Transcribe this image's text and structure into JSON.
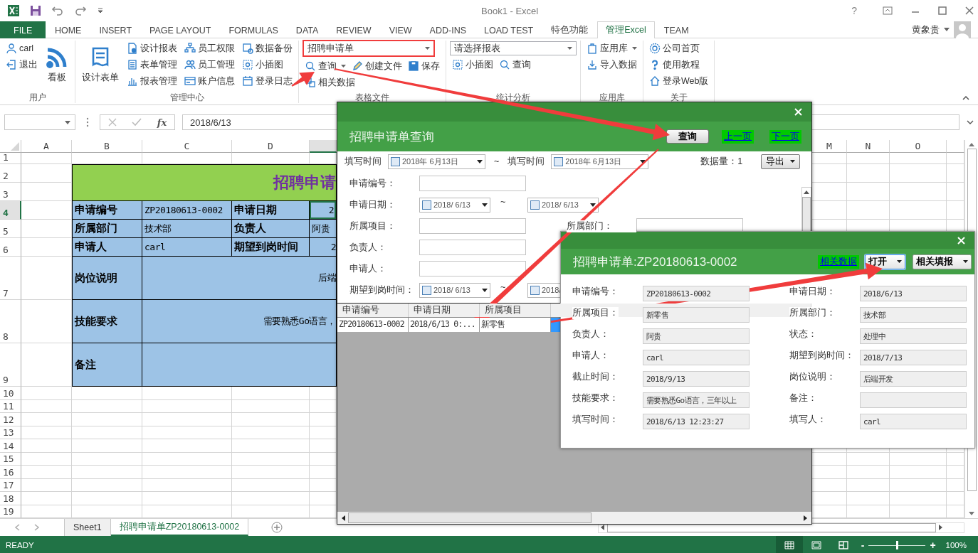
{
  "window": {
    "title": "Book1 - Excel",
    "help": "?"
  },
  "tabs": [
    {
      "label": "FILE",
      "kind": "file",
      "selected": false
    },
    {
      "label": "HOME",
      "kind": "tab",
      "selected": false
    },
    {
      "label": "INSERT",
      "kind": "tab",
      "selected": false
    },
    {
      "label": "PAGE LAYOUT",
      "kind": "tab",
      "selected": false
    },
    {
      "label": "FORMULAS",
      "kind": "tab",
      "selected": false
    },
    {
      "label": "DATA",
      "kind": "tab",
      "selected": false
    },
    {
      "label": "REVIEW",
      "kind": "tab",
      "selected": false
    },
    {
      "label": "VIEW",
      "kind": "tab",
      "selected": false
    },
    {
      "label": "ADD-INS",
      "kind": "tab",
      "selected": false
    },
    {
      "label": "LOAD TEST",
      "kind": "tab",
      "selected": false
    },
    {
      "label": "特色功能",
      "kind": "tab",
      "selected": false
    },
    {
      "label": "管理Excel",
      "kind": "tab",
      "selected": true
    },
    {
      "label": "TEAM",
      "kind": "tab",
      "selected": false
    }
  ],
  "account": {
    "name": "黄象贵"
  },
  "ribbon": [
    {
      "label": "用户",
      "columns": [
        [
          {
            "kind": "small",
            "label": "carl"
          },
          {
            "kind": "small",
            "label": "退出"
          }
        ],
        [
          {
            "kind": "large",
            "label": "看板"
          }
        ]
      ]
    },
    {
      "label": "管理中心",
      "columns": [
        [
          {
            "kind": "large",
            "label": "设计表单"
          }
        ],
        [
          {
            "kind": "small",
            "label": "设计报表"
          },
          {
            "kind": "small",
            "label": "表单管理"
          },
          {
            "kind": "small",
            "label": "报表管理"
          }
        ],
        [
          {
            "kind": "small",
            "label": "员工权限"
          },
          {
            "kind": "small",
            "label": "员工管理"
          },
          {
            "kind": "small",
            "label": "账户信息"
          }
        ],
        [
          {
            "kind": "small",
            "label": "数据备份"
          },
          {
            "kind": "small",
            "label": "小插图"
          },
          {
            "kind": "small",
            "label": "登录日志"
          }
        ]
      ]
    },
    {
      "label": "表格文件",
      "columns": [
        [
          {
            "kind": "combo",
            "label": "招聘申请单",
            "highlighted": true
          },
          {
            "kind": "row",
            "items": [
              {
                "kind": "split",
                "label": "查询"
              },
              {
                "kind": "small",
                "label": "创建文件"
              },
              {
                "kind": "small",
                "label": "保存"
              }
            ]
          },
          {
            "kind": "small",
            "label": "相关数据"
          }
        ]
      ]
    },
    {
      "label": "统计分析",
      "columns": [
        [
          {
            "kind": "combo",
            "label": "请选择报表",
            "highlighted": false
          },
          {
            "kind": "row",
            "items": [
              {
                "kind": "small",
                "label": "小插图"
              },
              {
                "kind": "small",
                "label": "查询"
              }
            ]
          }
        ]
      ]
    },
    {
      "label": "应用库",
      "columns": [
        [
          {
            "kind": "split",
            "label": "应用库"
          },
          {
            "kind": "small",
            "label": "导入数据"
          }
        ]
      ]
    },
    {
      "label": "关于",
      "columns": [
        [
          {
            "kind": "small",
            "label": "公司首页"
          },
          {
            "kind": "small",
            "label": "使用教程"
          },
          {
            "kind": "small",
            "label": "登录Web版"
          }
        ]
      ]
    }
  ],
  "formula_bar": {
    "function_label": "fx",
    "value": "2018/6/13"
  },
  "sheet": {
    "columns_left": [
      {
        "label": "A",
        "selected": false
      },
      {
        "label": "B",
        "selected": false
      },
      {
        "label": "C",
        "selected": false
      },
      {
        "label": "D",
        "selected": false
      },
      {
        "selected": true
      }
    ],
    "columns_right": [
      {
        "label": "M",
        "selected": false
      },
      {
        "label": "N",
        "selected": false
      },
      {
        "label": "O",
        "selected": false
      }
    ],
    "rows": [
      {
        "label": "1",
        "selected": false
      },
      {
        "label": "2",
        "selected": false
      },
      {
        "label": "3",
        "selected": false
      },
      {
        "label": "4",
        "selected": true
      },
      {
        "label": "5",
        "selected": false
      },
      {
        "label": "6",
        "selected": false
      },
      {
        "label": "7",
        "selected": false
      },
      {
        "label": "8",
        "selected": false
      },
      {
        "label": "9",
        "selected": false
      },
      {
        "label": "10",
        "selected": false
      },
      {
        "label": "11",
        "selected": false
      },
      {
        "label": "12",
        "selected": false
      },
      {
        "label": "13",
        "selected": false
      },
      {
        "label": "14",
        "selected": false
      },
      {
        "label": "15",
        "selected": false
      },
      {
        "label": "16",
        "selected": false
      },
      {
        "label": "17",
        "selected": false
      },
      {
        "label": "18",
        "selected": false
      },
      {
        "label": "19",
        "selected": false
      }
    ],
    "form": {
      "title": "招聘申请",
      "fields": [
        {
          "label": "申请编号",
          "value": "ZP20180613-0002",
          "label2": "申请日期",
          "value2": "2",
          "kind": "date"
        },
        {
          "label": "所属部门",
          "value": "技术部",
          "label2": "负责人",
          "value2": "阿贵",
          "kind": "text"
        },
        {
          "label": "申请人",
          "value": "carl",
          "label2": "期望到岗时间",
          "value2": "2",
          "kind": "date"
        }
      ],
      "blocks": [
        {
          "label": "岗位说明",
          "value": "后端"
        },
        {
          "label": "技能要求",
          "value": "需要熟悉Go语言，"
        },
        {
          "label": "备注"
        }
      ]
    }
  },
  "sheet_tabs": [
    {
      "label": "Sheet1",
      "selected": false
    },
    {
      "label": "招聘申请单ZP20180613-0002",
      "selected": true
    }
  ],
  "status_bar": {
    "text": "READY",
    "views": [
      {
        "selected": true
      },
      {
        "selected": false
      },
      {
        "selected": false
      }
    ],
    "zoom": {
      "minus": "-",
      "plus": "+",
      "level": 0.5,
      "reading": "100%"
    }
  },
  "query_dialog": {
    "title": "招聘申请单查询",
    "search_button": "查询",
    "prev_link": "上一页",
    "next_link": "下一页",
    "filter": {
      "label": "填写时间",
      "from": {
        "value": "2018年 6月13日",
        "checked": false
      },
      "separator": "~",
      "label_to": "填写时间",
      "to": {
        "value": "2018年 6月13日",
        "checked": false
      },
      "count": "数据量：1",
      "export_button": "导出"
    },
    "fields": [
      {
        "kind": "text",
        "label": "申请编号："
      },
      {
        "kind": "date_range",
        "label": "申请日期：",
        "from": {
          "value": "2018/ 6/13",
          "checked": false
        },
        "separator": "~",
        "to": {
          "value": "2018/ 6/13",
          "checked": false
        }
      },
      {
        "kind": "text",
        "label": "所属项目：",
        "label2": "所属部门："
      },
      {
        "kind": "text",
        "label": "负责人："
      },
      {
        "kind": "text",
        "label": "申请人："
      },
      {
        "kind": "date_range",
        "label": "期望到岗时间：",
        "from": {
          "value": "2018/ 6/13",
          "checked": false
        },
        "separator": "~",
        "to": {
          "value": "2018/",
          "checked": false
        }
      }
    ],
    "table": {
      "columns": [
        "申请编号",
        "申请日期",
        "所属项目"
      ],
      "rows": [
        {
          "cells": [
            {
              "text": "ZP20180613-0002",
              "selected": false
            },
            {
              "text": "2018/6/13 0:...",
              "selected": false
            },
            {
              "text": "新零售",
              "selected": false
            },
            {
              "selected": true
            }
          ]
        }
      ]
    }
  },
  "detail_dialog": {
    "title": "招聘申请单:ZP20180613-0002",
    "link": "相关数据",
    "open_button": {
      "label": "打开",
      "focused": true
    },
    "fill_button": "相关填报",
    "fields": [
      {
        "label": "申请编号：",
        "value": "ZP20180613-0002"
      },
      {
        "label": "申请日期：",
        "value": "2018/6/13"
      },
      {
        "label": "所属项目：",
        "value": "新零售"
      },
      {
        "label": "所属部门：",
        "value": "技术部"
      },
      {
        "label": "负责人：",
        "value": "阿贵"
      },
      {
        "label": "状态：",
        "value": "处理中"
      },
      {
        "label": "申请人：",
        "value": "carl"
      },
      {
        "label": "期望到岗时间：",
        "value": "2018/7/13"
      },
      {
        "label": "截止时间：",
        "value": "2018/9/13"
      },
      {
        "label": "岗位说明：",
        "value": "后端开发"
      },
      {
        "label": "技能要求：",
        "value": "需要熟悉Go语言，三年以上"
      },
      {
        "label": "备注："
      },
      {
        "label": "填写时间：",
        "value": "2018/6/13 12:23:27"
      },
      {
        "label": "填写人：",
        "value": "carl"
      }
    ]
  }
}
